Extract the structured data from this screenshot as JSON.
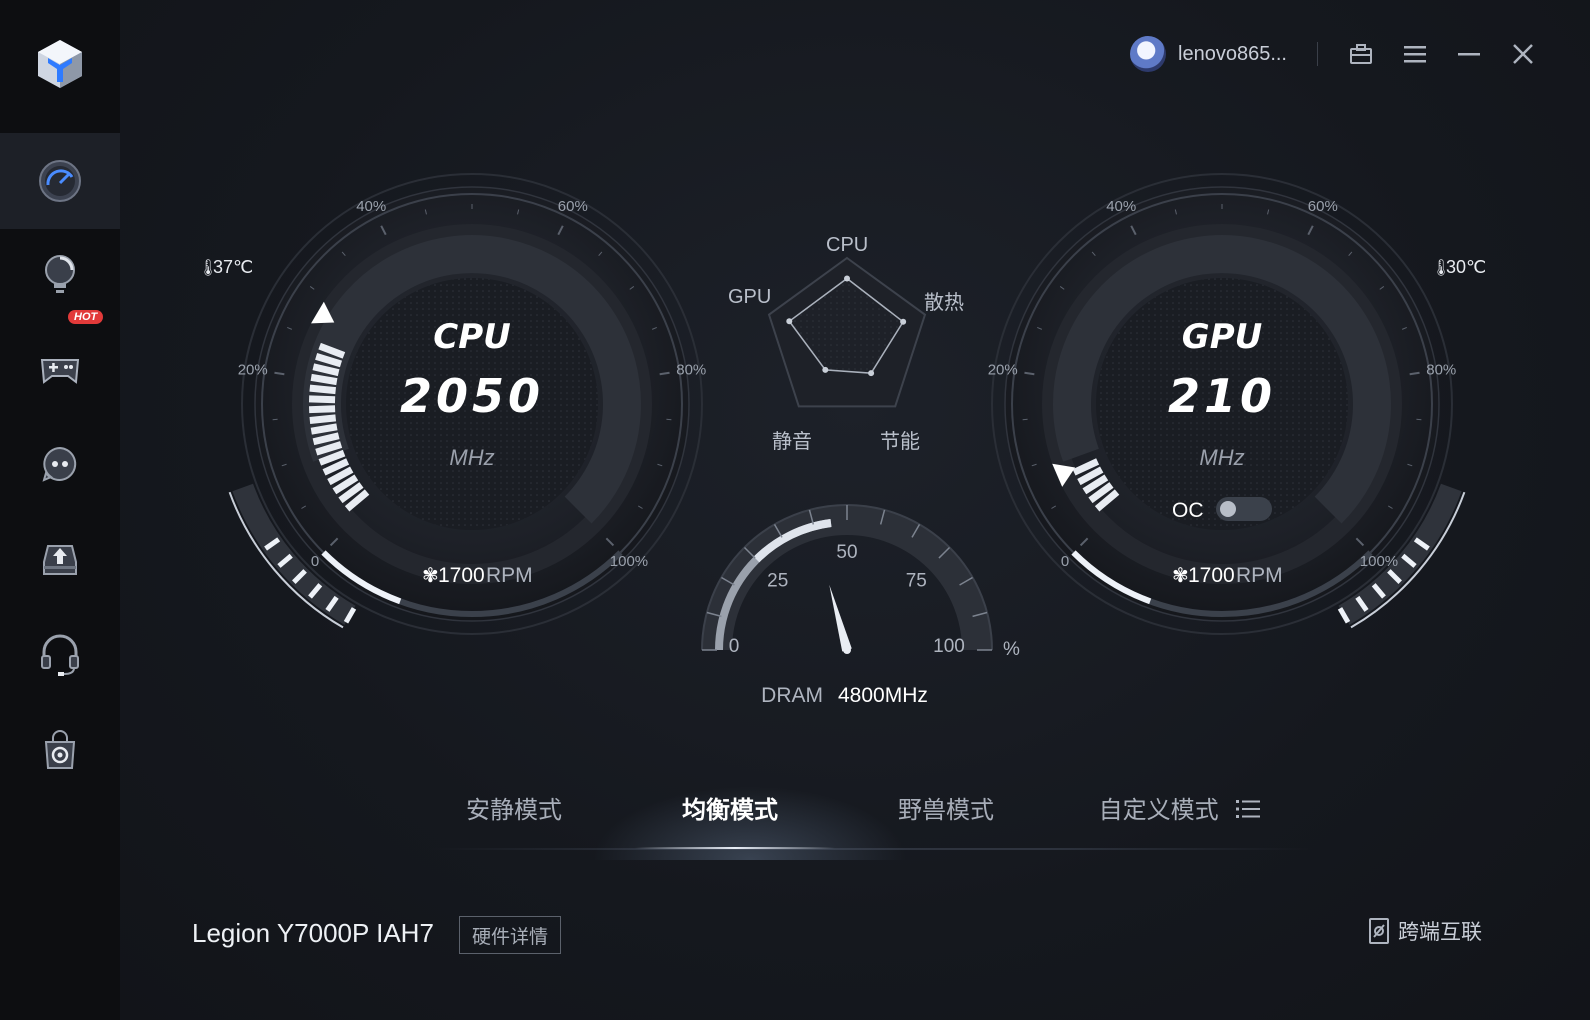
{
  "sidebar": {
    "items": [
      {
        "name": "performance-gauge-icon",
        "active": true
      },
      {
        "name": "lightbulb-icon",
        "active": false
      },
      {
        "name": "gamepad-icon",
        "active": false,
        "badge": "HOT"
      },
      {
        "name": "chat-bot-icon",
        "active": false
      },
      {
        "name": "upload-tray-icon",
        "active": false
      },
      {
        "name": "headset-icon",
        "active": false
      },
      {
        "name": "shopping-bag-icon",
        "active": false
      }
    ]
  },
  "header": {
    "username": "lenovo865...",
    "buttons": [
      "briefcase-icon",
      "menu-icon",
      "minimize-icon",
      "close-icon"
    ]
  },
  "cpu": {
    "title": "CPU",
    "value": "2050",
    "unit": "MHz",
    "temperature": "37℃",
    "fan": "1700",
    "fan_unit": "RPM",
    "usage_fraction": 0.28,
    "scale_labels": [
      "0",
      "20%",
      "40%",
      "60%",
      "80%",
      "100%"
    ]
  },
  "gpu": {
    "title": "GPU",
    "value": "210",
    "unit": "MHz",
    "temperature": "30℃",
    "fan": "1700",
    "fan_unit": "RPM",
    "oc_label": "OC",
    "oc_enabled": false,
    "usage_fraction": 0.08,
    "scale_labels": [
      "0",
      "20%",
      "40%",
      "60%",
      "80%",
      "100%"
    ]
  },
  "radar": {
    "labels": {
      "top": "CPU",
      "upper_right": "散热",
      "lower_right": "节能",
      "lower_left": "静音",
      "upper_left": "GPU"
    },
    "values": [
      0.75,
      0.72,
      0.5,
      0.45,
      0.74
    ]
  },
  "dram": {
    "label": "DRAM",
    "frequency": "4800MHz",
    "usage_percent": 46,
    "ticks": [
      "0",
      "25",
      "50",
      "75",
      "100"
    ],
    "unit": "%"
  },
  "modes": {
    "tabs": [
      "安静模式",
      "均衡模式",
      "野兽模式",
      "自定义模式"
    ],
    "active": 1
  },
  "footer": {
    "device": "Legion Y7000P IAH7",
    "hardware_button": "硬件详情",
    "connect": "跨端互联"
  },
  "colors": {
    "background": "#14171c",
    "sidebar": "#0d0e11",
    "accent": "#ffffff",
    "hot": "#e23a3a"
  }
}
